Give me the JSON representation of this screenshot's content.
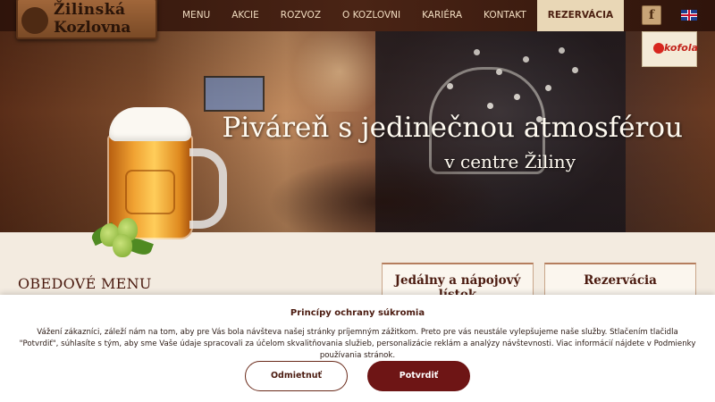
{
  "header": {
    "logo_line1": "Žilinská",
    "logo_line2": "Kozlovna",
    "nav": [
      "MENU",
      "AKCIE",
      "ROZVOZ",
      "O KOZLOVNI",
      "KARIÉRA",
      "KONTAKT",
      "REZERVÁCIA"
    ],
    "active_nav": "REZERVÁCIA",
    "facebook_glyph": "f",
    "language_icon": "uk-flag-icon"
  },
  "hero": {
    "title": "Piváreň s jedinečnou atmosférou",
    "subtitle": "v centre Žiliny"
  },
  "partner": {
    "name": "kofola"
  },
  "content": {
    "lunch_title": "OBEDOVÉ MENU",
    "cards": [
      "Jedálny a nápojový lístok",
      "Rezervácia"
    ]
  },
  "cookie": {
    "title": "Princípy ochrany súkromia",
    "text": "Vážení zákazníci, záleží nám na tom, aby pre Vás bola návšteva našej stránky príjemným zážitkom. Preto pre vás neustále vylepšujeme naše služby. Stlačením tlačidla \"Potvrdiť\", súhlasíte s tým, aby sme Vaše údaje spracovali za účelom skvalitňovania služieb, personalizácie reklám a analýzy návštevnosti. Viac informácií nájdete v Podmienky používania stránok.",
    "decline_label": "Odmietnuť",
    "confirm_label": "Potvrdiť"
  },
  "colors": {
    "header_bg": "#3b1a10",
    "accent": "#6e1515",
    "active_tab": "#e9d7b6",
    "text_dark": "#4b1b10"
  }
}
